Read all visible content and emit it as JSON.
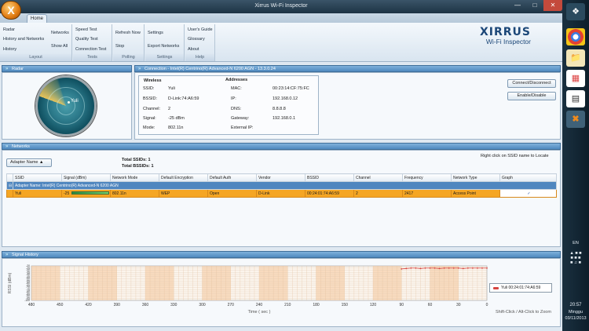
{
  "window": {
    "title": "Xirrus Wi-Fi Inspector",
    "tab": "Home"
  },
  "ribbon": {
    "groups": [
      {
        "label": "Layout",
        "items": [
          "Radar",
          "History and Networks",
          "History",
          "Networks",
          "Show All"
        ]
      },
      {
        "label": "Tests",
        "items": [
          "Speed Test",
          "Quality Test",
          "Connection Test"
        ]
      },
      {
        "label": "Polling",
        "items": [
          "Refresh Now",
          "Stop"
        ]
      },
      {
        "label": "Settings",
        "items": [
          "Settings",
          "Export Networks"
        ]
      },
      {
        "label": "Help",
        "items": [
          "User's Guide",
          "Glossary",
          "About"
        ]
      }
    ]
  },
  "logo": {
    "brand": "XIRRUS",
    "product": "Wi-Fi Inspector"
  },
  "radar": {
    "title": "Radar",
    "network_label": "Yuli"
  },
  "connection": {
    "title": "Connection - Intel(R) Centrino(R) Advanced-N 6200 AGN - 13.3.0.24",
    "wireless_heading": "Wireless",
    "wireless": [
      {
        "k": "SSID:",
        "v": "Yuli"
      },
      {
        "k": "BSSID:",
        "v": "D-Link:74:A6:59"
      },
      {
        "k": "Channel:",
        "v": "2"
      },
      {
        "k": "Signal:",
        "v": "-25 dBm"
      },
      {
        "k": "Mode:",
        "v": "802.11n"
      }
    ],
    "addresses_heading": "Addresses",
    "addresses": [
      {
        "k": "MAC:",
        "v": "00:23:14:CF:75:FC"
      },
      {
        "k": "IP:",
        "v": "192.168.0.12"
      },
      {
        "k": "DNS:",
        "v": "8.8.8.8"
      },
      {
        "k": "Gateway:",
        "v": "192.168.0.1"
      },
      {
        "k": "External IP:",
        "v": ""
      }
    ],
    "btn_connect": "Connect/Disconnect",
    "btn_enable": "Enable/Disable"
  },
  "networks": {
    "title": "Networks",
    "adapter_btn": "Adapter Name ▲",
    "total_ssids": "Total SSIDs: 1",
    "total_bssids": "Total BSSIDs: 1",
    "hint": "Right click on SSID name to Locate",
    "columns": [
      "SSID",
      "Signal (dBm)",
      "Network Mode",
      "Default Encryption",
      "Default Auth",
      "Vendor",
      "BSSID",
      "Channel",
      "Frequency",
      "Network Type",
      "Graph"
    ],
    "group_row": "Adapter Name: Intel(R) Centrino(R) Advanced-N 6200 AGN",
    "rows": [
      {
        "ssid": "Yuli",
        "signal": "-25",
        "mode": "802.11n",
        "enc": "WEP",
        "auth": "Open",
        "vendor": "D-Link",
        "bssid": "00:24:01:74:A6:59",
        "channel": "2",
        "freq": "2417",
        "type": "Access Point",
        "graph": "✓"
      }
    ]
  },
  "signal_history": {
    "title": "Signal History",
    "legend": "Yuli 00:24:01:74:A6:59",
    "hint": "Shift-Click / Alt-Click to Zoom"
  },
  "chart_data": {
    "type": "line",
    "title": "",
    "xlabel": "Time ( sec )",
    "ylabel": "RSSI (dBm)",
    "xlim": [
      480,
      0
    ],
    "ylim": [
      -100,
      -20
    ],
    "x_ticks": [
      "480",
      "450",
      "420",
      "390",
      "360",
      "330",
      "300",
      "270",
      "240",
      "210",
      "180",
      "150",
      "120",
      "90",
      "60",
      "30",
      "0"
    ],
    "y_ticks": [
      "-20",
      "-25",
      "-30",
      "-35",
      "-40",
      "-45",
      "-50",
      "-55",
      "-60",
      "-65",
      "-70",
      "-75",
      "-80",
      "-85",
      "-90",
      "-95",
      "-100"
    ],
    "series": [
      {
        "name": "Yuli 00:24:01:74:A6:59",
        "color": "#d64541",
        "x": [
          90,
          85,
          80,
          75,
          70,
          65,
          60,
          55,
          50,
          45,
          40,
          35,
          30,
          25,
          20,
          15,
          10,
          5,
          0
        ],
        "y": [
          -27,
          -26,
          -25,
          -25,
          -26,
          -25,
          -25,
          -25,
          -26,
          -25,
          -25,
          -25,
          -25,
          -26,
          -25,
          -25,
          -25,
          -25,
          -25
        ]
      }
    ]
  },
  "taskbar": {
    "lang": "EN",
    "time": "20:57",
    "day": "Minggu",
    "date": "03/11/2013"
  }
}
